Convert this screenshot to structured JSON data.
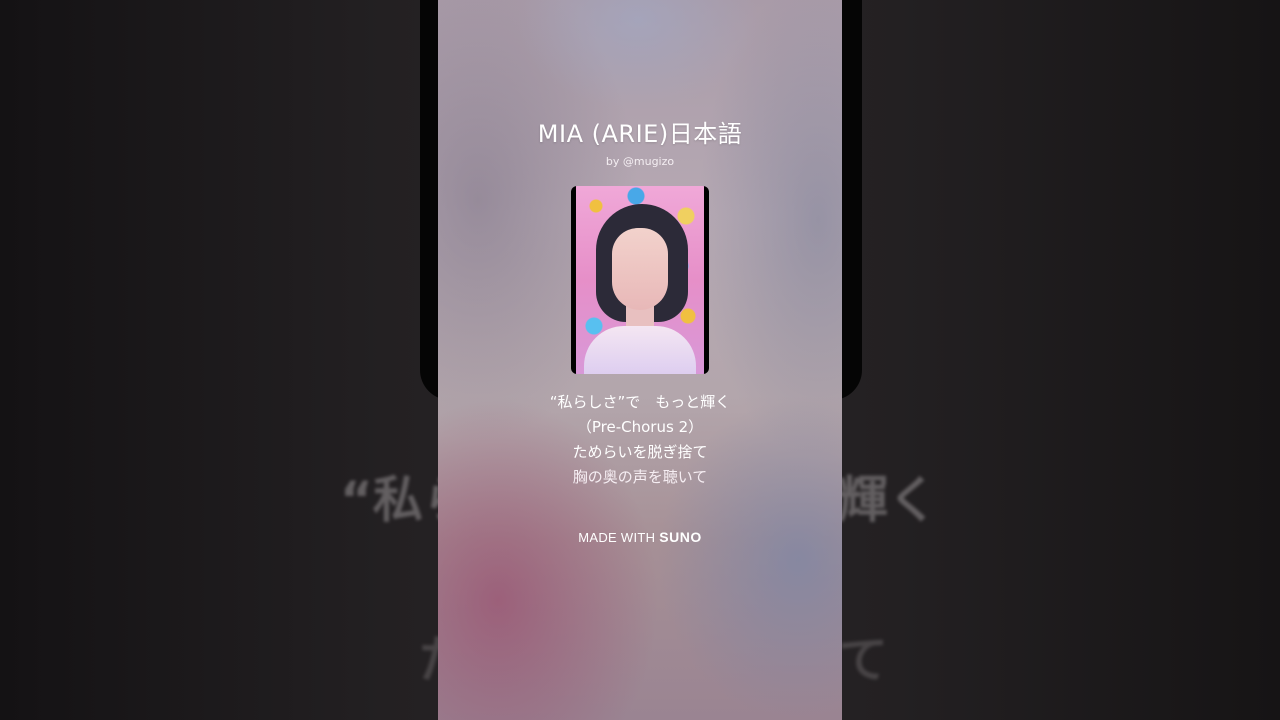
{
  "song": {
    "title": "MIA (ARIE)日本語",
    "byline": "by @mugizo"
  },
  "lyrics": [
    "“私らしさ”で　もっと輝く",
    "（Pre-Chorus 2）",
    "ためらいを脱ぎ捨て",
    "胸の奥の声を聴いて"
  ],
  "background_lyrics": {
    "left_top": "“私ら",
    "right_top": "輝く",
    "left_bottom": "た",
    "right_bottom": "て"
  },
  "footer": {
    "made_with": "MADE WITH",
    "brand": "SUNO"
  },
  "icons": {
    "cover": "cover-art-portrait"
  }
}
